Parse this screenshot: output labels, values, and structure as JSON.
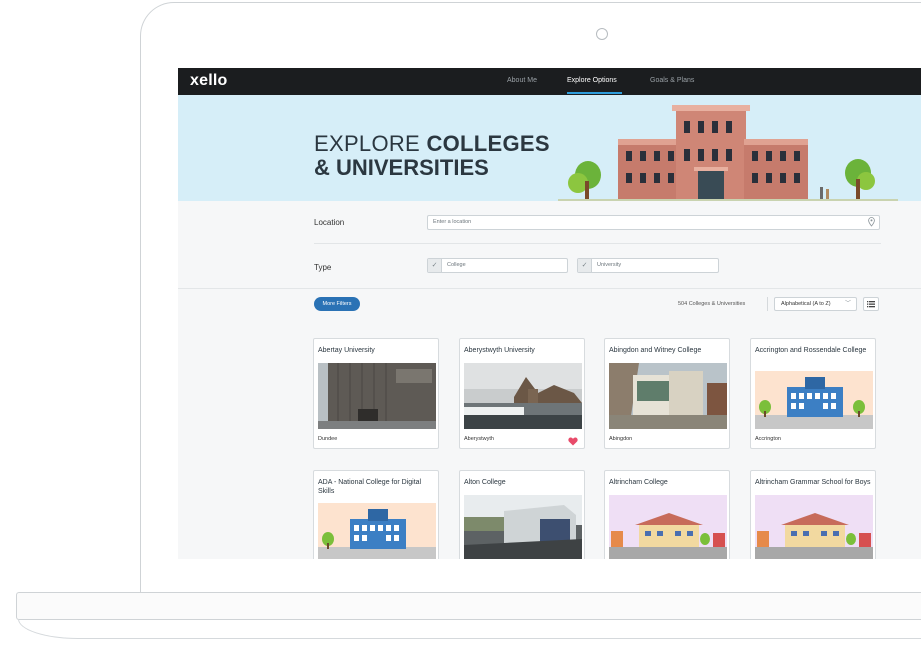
{
  "nav": {
    "logo": "xello",
    "items": [
      {
        "label": "About Me",
        "active": false
      },
      {
        "label": "Explore Options",
        "active": true
      },
      {
        "label": "Goals & Plans",
        "active": false
      }
    ]
  },
  "banner": {
    "title_light": "EXPLORE ",
    "title_bold_1": "COLLEGES",
    "title_line2": "& UNIVERSITIES"
  },
  "filters": {
    "location_label": "Location",
    "location_placeholder": "Enter a location",
    "type_label": "Type",
    "type_options": [
      "College",
      "University"
    ]
  },
  "toolbar": {
    "more_filters": "More Filters",
    "results": "504 Colleges & Universities",
    "sort_value": "Alphabetical (A to Z)"
  },
  "cards": [
    {
      "name": "Abertay University",
      "city": "Dundee",
      "favorite": false,
      "image": "photo-building"
    },
    {
      "name": "Aberystwyth University",
      "city": "Aberystwyth",
      "favorite": true,
      "image": "photo-seaside"
    },
    {
      "name": "Abingdon and Witney College",
      "city": "Abingdon",
      "favorite": false,
      "image": "photo-modern"
    },
    {
      "name": "Accrington and Rossendale College",
      "city": "Accrington",
      "favorite": false,
      "image": "illustration-blue"
    },
    {
      "name": "ADA - National College for Digital Skills",
      "city": "",
      "favorite": false,
      "image": "illustration-blue"
    },
    {
      "name": "Alton College",
      "city": "",
      "favorite": false,
      "image": "photo-campus"
    },
    {
      "name": "Altrincham College",
      "city": "",
      "favorite": false,
      "image": "illustration-houses"
    },
    {
      "name": "Altrincham Grammar School for Boys",
      "city": "",
      "favorite": false,
      "image": "illustration-houses"
    }
  ],
  "colors": {
    "accent": "#2a72b5",
    "nav_bg": "#1b1d1f",
    "banner_bg": "#d6eef8",
    "heart": "#e84b6a"
  }
}
